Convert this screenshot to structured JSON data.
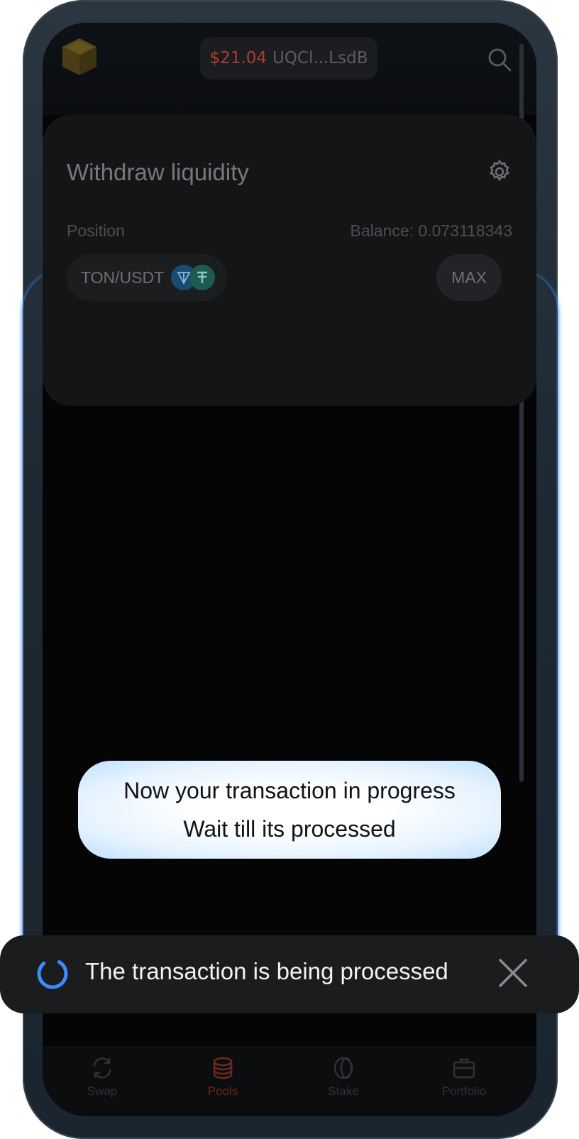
{
  "header": {
    "wallet_amount": "$21.04",
    "wallet_address": "UQCl...LsdB"
  },
  "withdraw": {
    "title": "Withdraw liquidity",
    "position_label": "Position",
    "balance_label": "Balance: 0.073118343",
    "pair": "TON/USDT",
    "max_label": "MAX"
  },
  "tip": {
    "line1": "Now your transaction in progress",
    "line2": "Wait till its processed"
  },
  "toast": {
    "message": "The transaction is being processed"
  },
  "nav": {
    "items": [
      {
        "label": "Swap",
        "icon": "swap-icon"
      },
      {
        "label": "Pools",
        "icon": "pools-icon",
        "active": true
      },
      {
        "label": "Stake",
        "icon": "stake-icon"
      },
      {
        "label": "Portfolio",
        "icon": "portfolio-icon"
      }
    ]
  },
  "colors": {
    "accent": "#a8402c",
    "spinner": "#3d8bff",
    "tip_glow": "#bfe0ff"
  }
}
